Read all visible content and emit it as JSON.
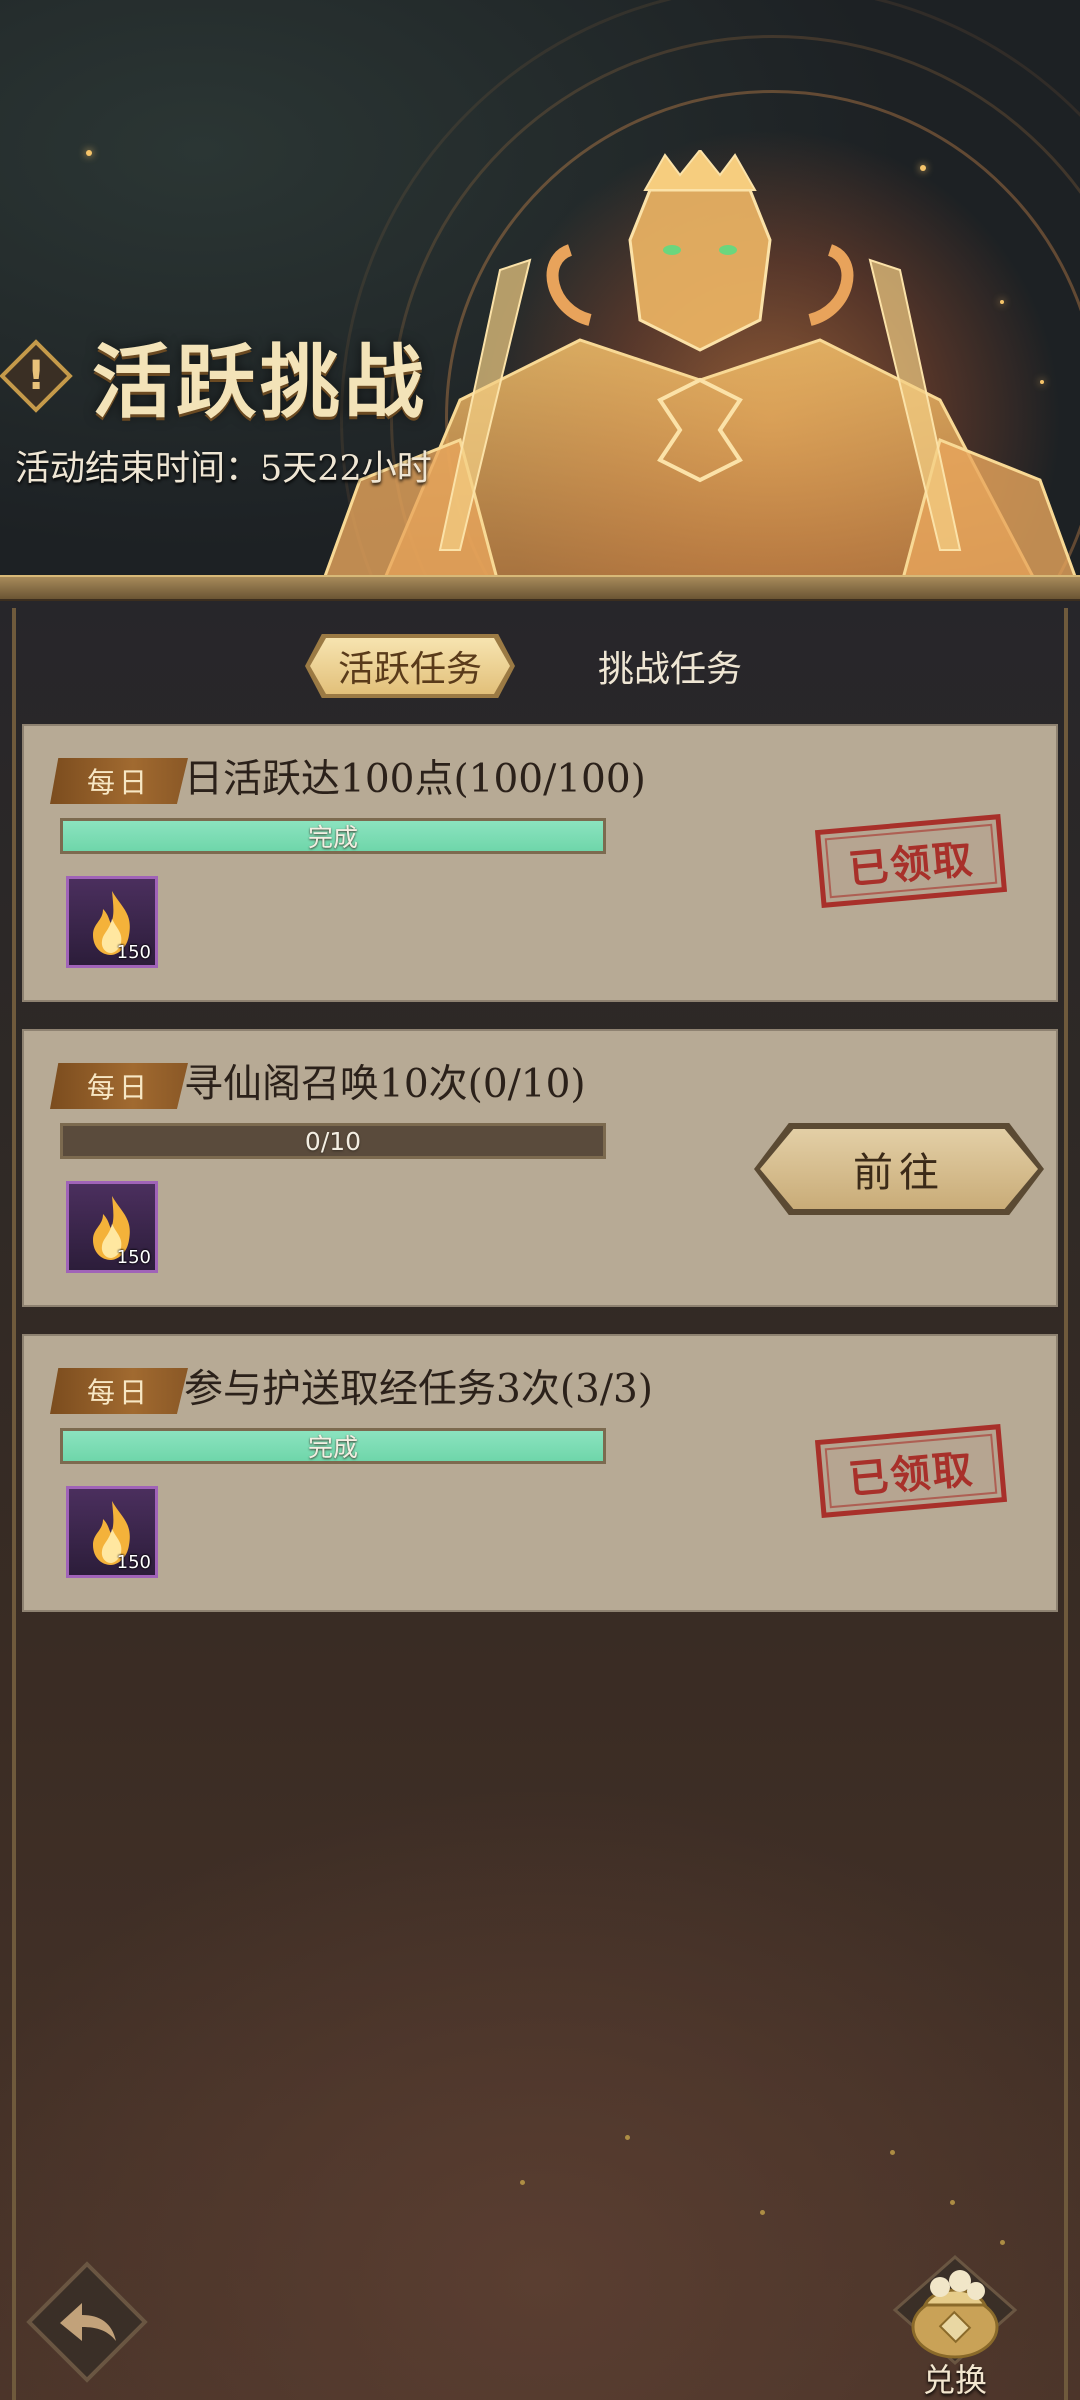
{
  "header": {
    "title": "活跃挑战",
    "end_time": "活动结束时间：5天22小时",
    "alert_icon_glyph": "!"
  },
  "tabs": [
    {
      "label": "活跃任务",
      "active": true
    },
    {
      "label": "挑战任务",
      "active": false
    }
  ],
  "tasks": [
    {
      "badge": "每日",
      "title": "日活跃达100点(100/100)",
      "progress_text": "完成",
      "progress": 1.0,
      "reward_icon": "fire-icon",
      "reward_qty": "150",
      "status": "已领取"
    },
    {
      "badge": "每日",
      "title": "寻仙阁召唤10次(0/10)",
      "progress_text": "0/10",
      "progress": 0.0,
      "reward_icon": "fire-icon",
      "reward_qty": "150",
      "action_label": "前往"
    },
    {
      "badge": "每日",
      "title": "参与护送取经任务3次(3/3)",
      "progress_text": "完成",
      "progress": 1.0,
      "reward_icon": "fire-icon",
      "reward_qty": "150",
      "status": "已领取"
    }
  ],
  "bottom": {
    "back_icon": "back-arrow-icon",
    "exchange_label": "兑换",
    "exchange_icon": "treasure-pouch-icon"
  },
  "colors": {
    "progress_fill": "#6fd6aa",
    "stamp_red": "#a8302a",
    "card_bg": "#b7aa95",
    "title_gold": "#f3e3b8"
  }
}
